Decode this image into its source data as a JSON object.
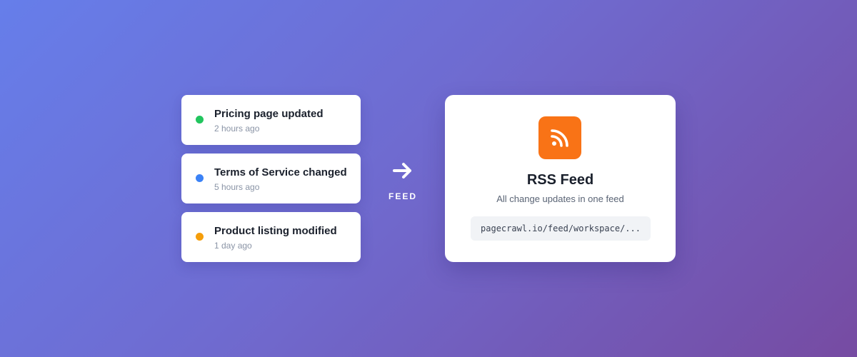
{
  "changes": [
    {
      "title": "Pricing page updated",
      "time": "2 hours ago",
      "dot_color": "#22c55e"
    },
    {
      "title": "Terms of Service changed",
      "time": "5 hours ago",
      "dot_color": "#3b82f6"
    },
    {
      "title": "Product listing modified",
      "time": "1 day ago",
      "dot_color": "#f59e0b"
    }
  ],
  "connector": {
    "icon": "arrow-right-icon",
    "label": "FEED"
  },
  "feed": {
    "icon": "rss-icon",
    "icon_bg": "#f97316",
    "title": "RSS Feed",
    "subtitle": "All change updates in one feed",
    "url": "pagecrawl.io/feed/workspace/..."
  }
}
